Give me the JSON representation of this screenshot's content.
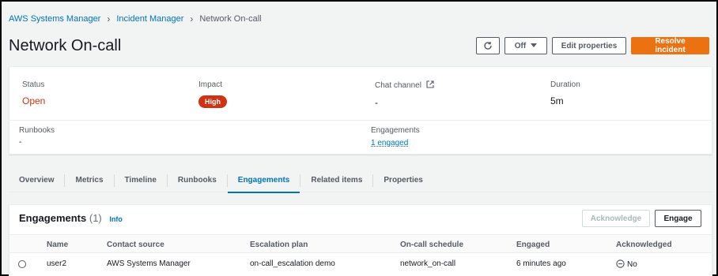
{
  "breadcrumb": {
    "items": [
      "AWS Systems Manager",
      "Incident Manager"
    ],
    "current": "Network On-call"
  },
  "page": {
    "title": "Network On-call"
  },
  "header_actions": {
    "off_label": "Off",
    "edit_label": "Edit properties",
    "resolve_label": "Resolve incident"
  },
  "summary": {
    "status_label": "Status",
    "status_value": "Open",
    "impact_label": "Impact",
    "impact_value": "High",
    "chat_label": "Chat channel",
    "chat_value": "-",
    "duration_label": "Duration",
    "duration_value": "5m",
    "runbooks_label": "Runbooks",
    "runbooks_value": "-",
    "engagements_label": "Engagements",
    "engagements_value": "1 engaged"
  },
  "tabs": [
    {
      "label": "Overview"
    },
    {
      "label": "Metrics"
    },
    {
      "label": "Timeline"
    },
    {
      "label": "Runbooks"
    },
    {
      "label": "Engagements"
    },
    {
      "label": "Related items"
    },
    {
      "label": "Properties"
    }
  ],
  "active_tab": "Engagements",
  "engagements_panel": {
    "title": "Engagements",
    "count": "(1)",
    "info": "Info",
    "acknowledge_label": "Acknowledge",
    "engage_label": "Engage",
    "columns": [
      "Name",
      "Contact source",
      "Escalation plan",
      "On-call schedule",
      "Engaged",
      "Acknowledged"
    ],
    "rows": [
      {
        "name": "user2",
        "contact_source": "AWS Systems Manager",
        "escalation_plan": "on-call_escalation demo",
        "schedule": "network_on-call",
        "engaged": "6 minutes ago",
        "acknowledged": "No"
      }
    ]
  },
  "colors": {
    "link": "#0073bb",
    "primary": "#ec7211",
    "danger": "#d13212"
  }
}
